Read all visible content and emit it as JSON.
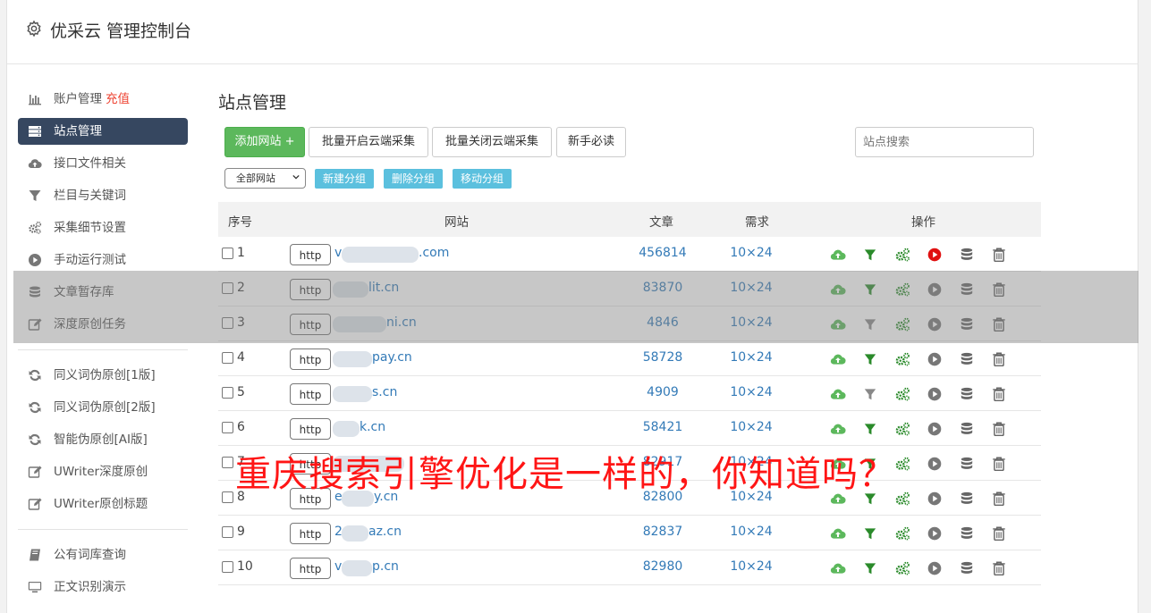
{
  "header": {
    "title": "优采云 管理控制台"
  },
  "sidebar": {
    "items": [
      {
        "label": "账户管理",
        "extra": "充值",
        "icon": "bar-chart-icon"
      },
      {
        "label": "站点管理",
        "icon": "server-icon",
        "active": true
      },
      {
        "label": "接口文件相关",
        "icon": "cloud-upload-icon"
      },
      {
        "label": "栏目与关键词",
        "icon": "filter-icon"
      },
      {
        "label": "采集细节设置",
        "icon": "cogs-icon"
      },
      {
        "label": "手动运行测试",
        "icon": "play-circle-icon"
      },
      {
        "label": "文章暂存库",
        "icon": "database-icon"
      },
      {
        "label": "深度原创任务",
        "icon": "edit-icon"
      }
    ],
    "items2": [
      {
        "label": "同义词伪原创[1版]",
        "icon": "refresh-icon"
      },
      {
        "label": "同义词伪原创[2版]",
        "icon": "refresh-icon"
      },
      {
        "label": "智能伪原创[AI版]",
        "icon": "refresh-icon"
      },
      {
        "label": "UWriter深度原创",
        "icon": "edit-icon"
      },
      {
        "label": "UWriter原创标题",
        "icon": "edit-icon"
      }
    ],
    "items3": [
      {
        "label": "公有词库查询",
        "icon": "book-icon"
      },
      {
        "label": "正文识别演示",
        "icon": "monitor-icon"
      }
    ]
  },
  "main": {
    "title": "站点管理",
    "buttons": {
      "add": "添加网站 +",
      "batch_on": "批量开启云端采集",
      "batch_off": "批量关闭云端采集",
      "guide": "新手必读"
    },
    "search_placeholder": "站点搜索",
    "group_select": "全部网站",
    "group_buttons": {
      "new": "新建分组",
      "del": "删除分组",
      "move": "移动分组"
    },
    "columns": {
      "no": "序号",
      "site": "网站",
      "articles": "文章",
      "demand": "需求",
      "ops": "操作"
    },
    "protocol": "http",
    "rows": [
      {
        "no": "1",
        "site_prefix": "v",
        "site": ".com",
        "articles": "456814",
        "demand": "10×24",
        "filter_active": true,
        "play_active": true
      },
      {
        "no": "2",
        "site_prefix": "",
        "site": "lit.cn",
        "articles": "83870",
        "demand": "10×24",
        "filter_active": true,
        "play_active": false
      },
      {
        "no": "3",
        "site_prefix": "",
        "site": "ni.cn",
        "articles": "4846",
        "demand": "10×24",
        "filter_active": false,
        "play_active": false
      },
      {
        "no": "4",
        "site_prefix": "",
        "site": "pay.cn",
        "articles": "58728",
        "demand": "10×24",
        "filter_active": true,
        "play_active": false
      },
      {
        "no": "5",
        "site_prefix": "",
        "site": "s.cn",
        "articles": "4909",
        "demand": "10×24",
        "filter_active": false,
        "play_active": false
      },
      {
        "no": "6",
        "site_prefix": "",
        "site": "k.cn",
        "articles": "58421",
        "demand": "10×24",
        "filter_active": true,
        "play_active": false
      },
      {
        "no": "7",
        "site_prefix": "",
        "site": "",
        "articles": "82917",
        "demand": "10×24",
        "filter_active": true,
        "play_active": false
      },
      {
        "no": "8",
        "site_prefix": "e",
        "site": "y.cn",
        "articles": "82800",
        "demand": "10×24",
        "filter_active": true,
        "play_active": false
      },
      {
        "no": "9",
        "site_prefix": "2",
        "site": "az.cn",
        "articles": "82837",
        "demand": "10×24",
        "filter_active": true,
        "play_active": false
      },
      {
        "no": "10",
        "site_prefix": "v",
        "site": "p.cn",
        "articles": "82980",
        "demand": "10×24",
        "filter_active": true,
        "play_active": false
      }
    ]
  },
  "overlay_text": "重庆搜索引擎优化是一样的，你知道吗？",
  "colors": {
    "green": "#5cb85c",
    "link": "#337ab7",
    "sidebar_active": "#364760",
    "red_text": "#ff1515",
    "play_active": "#e01010"
  }
}
